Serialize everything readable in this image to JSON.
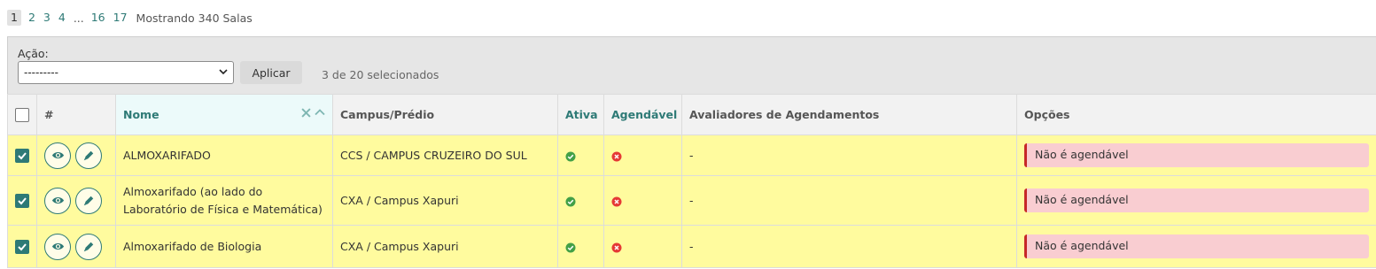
{
  "pagination": {
    "current": "1",
    "pages": [
      "2",
      "3",
      "4"
    ],
    "ellipsis": "...",
    "tail_pages": [
      "16",
      "17"
    ],
    "summary": "Mostrando 340 Salas"
  },
  "action_bar": {
    "label": "Ação:",
    "select_value": "---------",
    "apply_label": "Aplicar",
    "selected_count": "3 de 20 selecionados"
  },
  "table": {
    "headers": {
      "hash": "#",
      "nome": "Nome",
      "campus": "Campus/Prédio",
      "ativa": "Ativa",
      "agendavel": "Agendável",
      "avaliadores": "Avaliadores de Agendamentos",
      "opcoes": "Opções"
    },
    "rows": [
      {
        "nome": "ALMOXARIFADO",
        "campus": "CCS / CAMPUS CRUZEIRO DO SUL",
        "ativa": "yes",
        "agendavel": "no",
        "avaliadores": "-",
        "opcao": "Não é agendável",
        "checked": true
      },
      {
        "nome": "Almoxarifado (ao lado do Laboratório de Física e Matemática)",
        "campus": "CXA / Campus Xapuri",
        "ativa": "yes",
        "agendavel": "no",
        "avaliadores": "-",
        "opcao": "Não é agendável",
        "checked": true
      },
      {
        "nome": "Almoxarifado de Biologia",
        "campus": "CXA / Campus Xapuri",
        "ativa": "yes",
        "agendavel": "no",
        "avaliadores": "-",
        "opcao": "Não é agendável",
        "checked": true
      }
    ]
  },
  "icons": {
    "view": "eye-icon",
    "edit": "pencil-icon",
    "active": "check-circle-icon",
    "inactive": "x-circle-icon",
    "clear_sort": "x-icon",
    "sort_asc": "chevron-up-icon"
  },
  "colors": {
    "accent": "#2e7a76",
    "selected_row": "#fffb9e",
    "danger_bg": "#f9cdd1",
    "danger_border": "#c62828",
    "success": "#43a047",
    "error": "#e53935"
  }
}
